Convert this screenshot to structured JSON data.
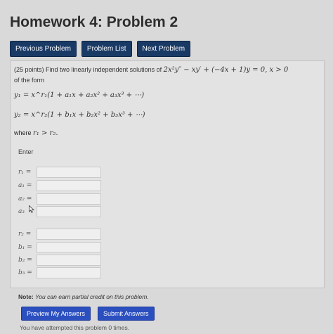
{
  "header": {
    "title": "Homework 4: Problem 2"
  },
  "nav": {
    "previous": "Previous Problem",
    "list": "Problem List",
    "next": "Next Problem"
  },
  "problem": {
    "intro": "(25 points) Find two linearly independent solutions of",
    "equation": "2x²y″ − xy′ + (−4x + 1)y = 0, x > 0",
    "of_the_form": "of the form",
    "y1": "y₁ = x^r₁(1 + a₁x + a₂x² + a₃x³ + ⋯)",
    "y2": "y₂ = x^r₂(1 + b₁x + b₂x² + b₃x³ + ⋯)",
    "where": "where",
    "where_cond": "r₁ > r₂.",
    "enter": "Enter"
  },
  "fields": {
    "r1": "r₁ =",
    "a1": "a₁ =",
    "a2": "a₂ =",
    "a3": "a₃",
    "r2": "r₂ =",
    "b1": "b₁ =",
    "b2": "b₂ =",
    "b3": "b₃ ="
  },
  "note": {
    "label": "Note:",
    "text": "You can earn partial credit on this problem."
  },
  "actions": {
    "preview": "Preview My Answers",
    "submit": "Submit Answers"
  },
  "status": "You have attempted this problem 0 times."
}
